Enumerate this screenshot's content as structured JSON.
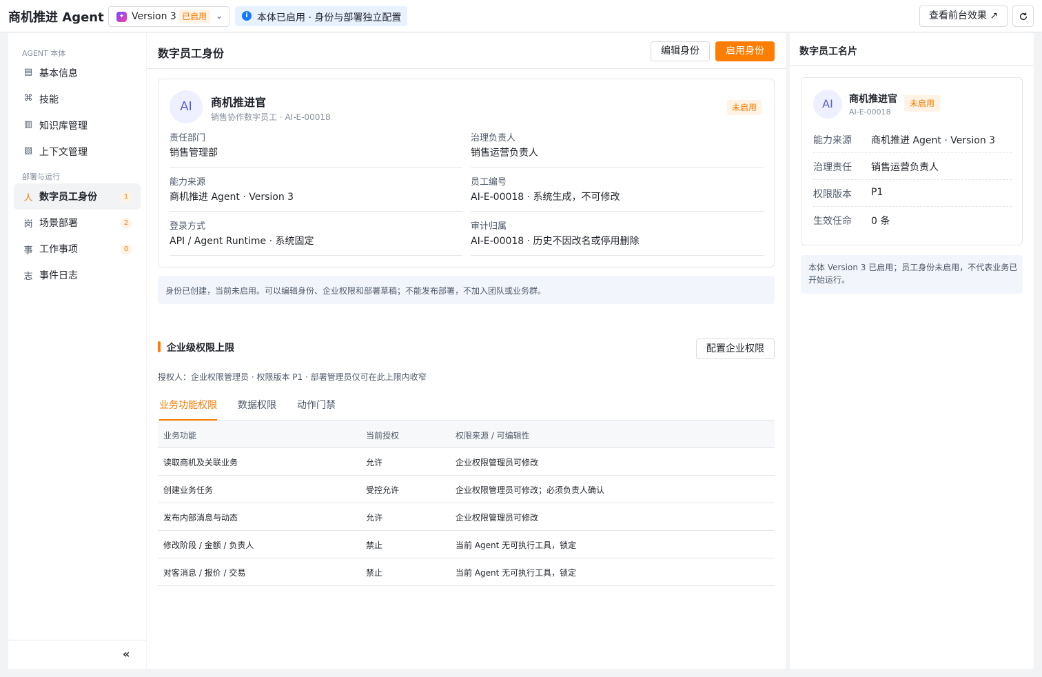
{
  "topbar": {
    "app_title": "商机推进 Agent",
    "separator": "·",
    "version": {
      "name": "Version 3",
      "badge": "已启用",
      "chevron": "⌄"
    },
    "info": "本体已启用 · 身份与部署独立配置",
    "preview_button": "查看前台效果 ↗",
    "refresh_icon": "refresh-icon"
  },
  "sidebar": {
    "group1": "AGENT 本体",
    "group2": "部署与运行",
    "items": [
      {
        "label": "基本信息",
        "icon": "▤"
      },
      {
        "label": "技能",
        "icon": "⌘"
      },
      {
        "label": "知识库管理",
        "icon": "▥"
      },
      {
        "label": "上下文管理",
        "icon": "▧"
      },
      {
        "label": "数字员工身份",
        "icon": "人",
        "count": "1"
      },
      {
        "label": "场景部署",
        "icon": "岗",
        "count": "2"
      },
      {
        "label": "工作事项",
        "icon": "事",
        "count": "0"
      },
      {
        "label": "事件日志",
        "icon": "志"
      }
    ],
    "collapse": "«"
  },
  "main": {
    "title": "数字员工身份",
    "edit_button": "编辑身份",
    "enable_button": "启用身份",
    "card": {
      "avatar": "AI",
      "name": "商机推进官",
      "sub": "销售协作数字员工 · AI-E-00018",
      "status": "未启用",
      "fields": [
        {
          "label": "责任部门",
          "value": "销售管理部"
        },
        {
          "label": "治理负责人",
          "value": "销售运营负责人"
        },
        {
          "label": "能力来源",
          "value": "商机推进 Agent · Version 3"
        },
        {
          "label": "员工编号",
          "value": "AI-E-00018 · 系统生成，不可修改"
        },
        {
          "label": "登录方式",
          "value": "API / Agent Runtime · 系统固定"
        },
        {
          "label": "审计归属",
          "value": "AI-E-00018 · 历史不因改名或停用删除"
        }
      ]
    },
    "notice": "身份已创建，当前未启用。可以编辑身份、企业权限和部署草稿；不能发布部署，不加入团队或业务群。",
    "section_title": "企业级权限上限",
    "config_button": "配置企业权限",
    "grantor": "授权人：企业权限管理员 · 权限版本 P1 · 部署管理员仅可在此上限内收窄",
    "tabs": [
      "业务功能权限",
      "数据权限",
      "动作门禁"
    ],
    "table": {
      "headers": [
        "业务功能",
        "当前授权",
        "权限来源 / 可编辑性"
      ],
      "rows": [
        [
          "读取商机及关联业务",
          "允许",
          "企业权限管理员可修改"
        ],
        [
          "创建业务任务",
          "受控允许",
          "企业权限管理员可修改；必须负责人确认"
        ],
        [
          "发布内部消息与动态",
          "允许",
          "企业权限管理员可修改"
        ],
        [
          "修改阶段 / 金额 / 负责人",
          "禁止",
          "当前 Agent 无可执行工具，锁定"
        ],
        [
          "对客消息 / 报价 / 交易",
          "禁止",
          "当前 Agent 无可执行工具，锁定"
        ]
      ]
    }
  },
  "right": {
    "title": "数字员工名片",
    "avatar": "AI",
    "name": "商机推进官",
    "badge": "未启用",
    "id": "AI-E-00018",
    "rows": [
      {
        "label": "能力来源",
        "value": "商机推进 Agent · Version 3"
      },
      {
        "label": "治理责任",
        "value": "销售运营负责人"
      },
      {
        "label": "权限版本",
        "value": "P1"
      },
      {
        "label": "生效任命",
        "value": "0 条"
      }
    ],
    "notice": "本体 Version 3 已启用；员工身份未启用，不代表业务已开始运行。"
  },
  "colors": {
    "accent": "#ff7d00",
    "info": "#1677ff",
    "avatar": "#5b5bd6"
  }
}
